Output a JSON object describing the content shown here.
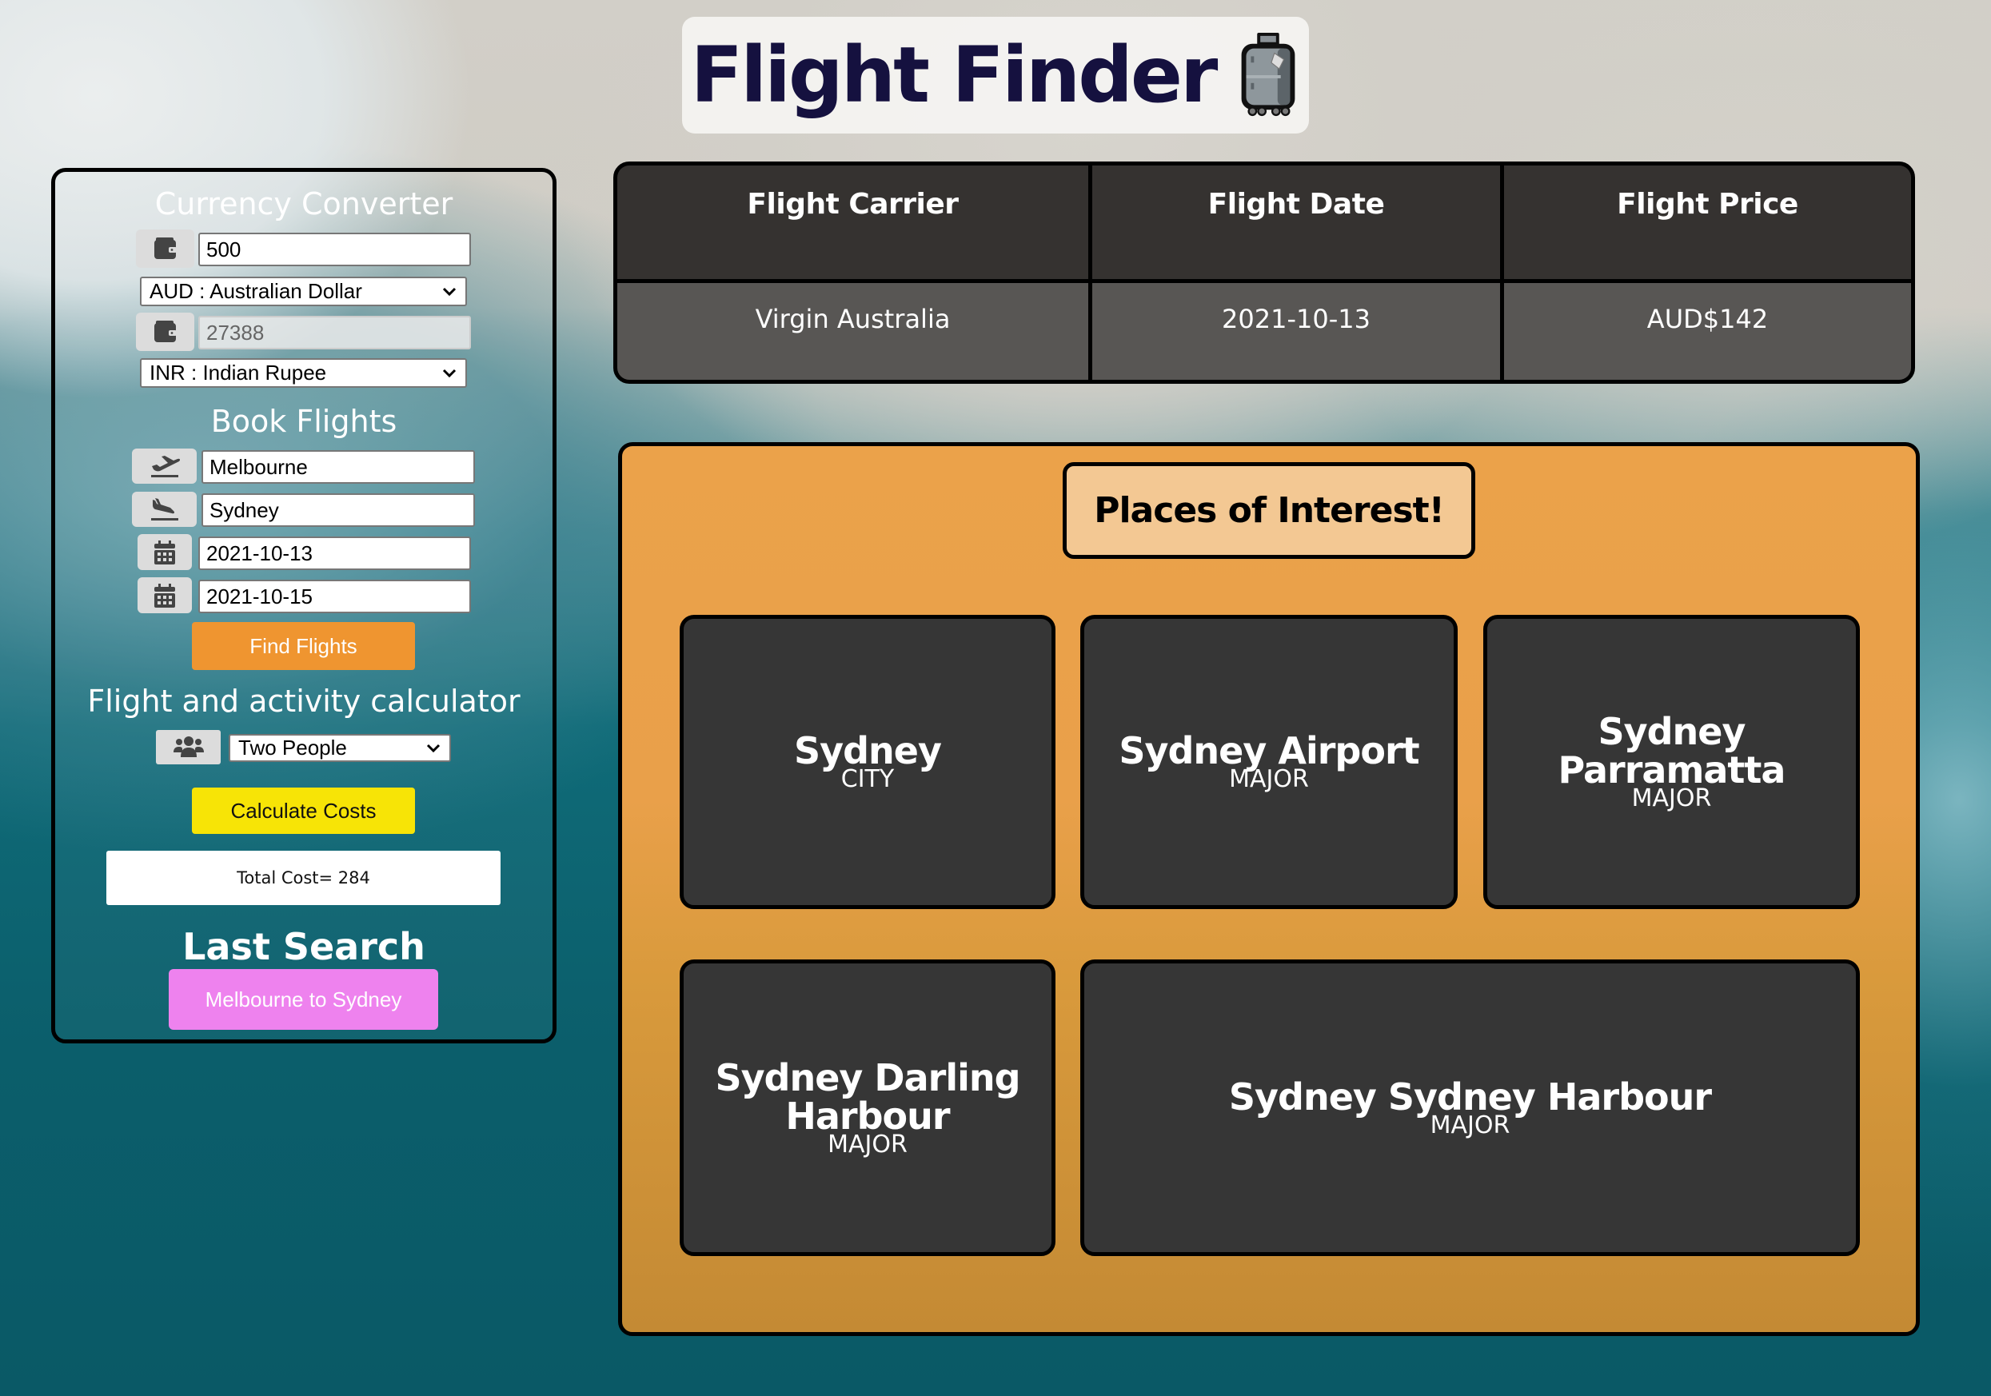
{
  "header": {
    "title": "Flight Finder",
    "title_icon": "luggage-icon"
  },
  "currency_converter": {
    "heading": "Currency Converter",
    "amount_icon": "wallet-icon",
    "amount_value": "500",
    "from_currency": "AUD : Australian Dollar",
    "converted_icon": "wallet-icon",
    "converted_value": "27388",
    "to_currency": "INR : Indian Rupee"
  },
  "book_flights": {
    "heading": "Book Flights",
    "origin_icon": "plane-departure-icon",
    "origin_value": "Melbourne",
    "destination_icon": "plane-arrival-icon",
    "destination_value": "Sydney",
    "depart_date_icon": "calendar-icon",
    "depart_date": "2021-10-13",
    "return_date_icon": "calendar-icon",
    "return_date": "2021-10-15",
    "find_button": "Find Flights"
  },
  "calculator": {
    "heading": "Flight and activity calculator",
    "people_icon": "users-icon",
    "people_selected": "Two People",
    "calculate_button": "Calculate Costs",
    "total_label": "Total Cost= 284"
  },
  "last_search": {
    "heading": "Last Search",
    "button": "Melbourne to Sydney"
  },
  "flight_table": {
    "columns": [
      "Flight Carrier",
      "Flight Date",
      "Flight Price"
    ],
    "rows": [
      [
        "Virgin Australia",
        "2021-10-13",
        "AUD$142"
      ]
    ]
  },
  "places": {
    "heading": "Places of Interest!",
    "items": [
      {
        "name": "Sydney",
        "type": "CITY"
      },
      {
        "name": "Sydney Airport",
        "type": "MAJOR"
      },
      {
        "name": "Sydney Parramatta",
        "type": "MAJOR"
      },
      {
        "name": "Sydney Darling Harbour",
        "type": "MAJOR"
      },
      {
        "name": "Sydney Sydney Harbour",
        "type": "MAJOR"
      }
    ]
  },
  "colors": {
    "title_text": "#15113f",
    "find_button": "#ef9530",
    "calculate_button": "#f7e406",
    "last_search_button": "#ee82ee",
    "places_panel": "#eba24a",
    "places_header": "#f3c893",
    "card_bg": "#363636"
  }
}
